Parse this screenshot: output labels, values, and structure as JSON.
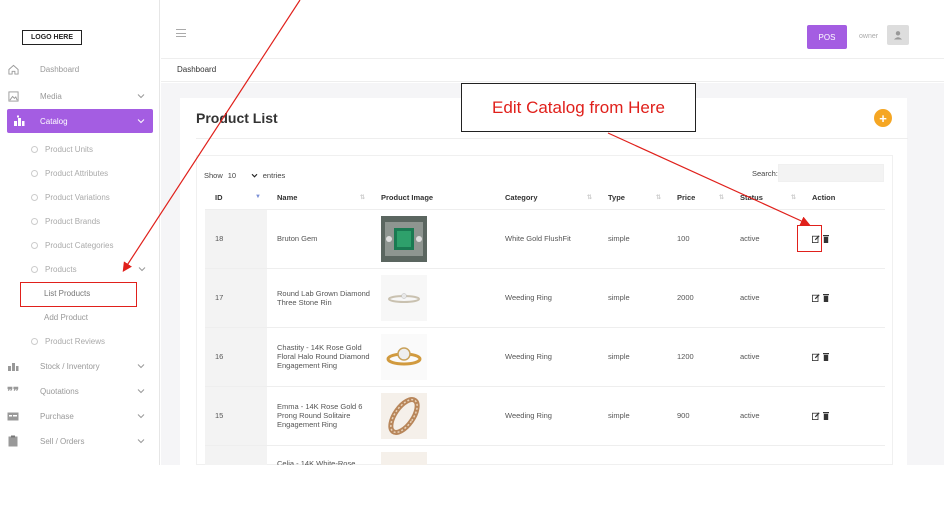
{
  "brand": {
    "logo_text": "LOGO HERE"
  },
  "topbar": {
    "pos_label": "POS",
    "user_name": "owner"
  },
  "breadcrumb": "Dashboard",
  "sidebar": {
    "items": [
      {
        "label": "Dashboard",
        "icon": "home-icon"
      },
      {
        "label": "Media",
        "icon": "image-icon"
      },
      {
        "label": "Catalog",
        "icon": "catalog-icon"
      }
    ],
    "catalog_sub": [
      "Product Units",
      "Product Attributes",
      "Product Variations",
      "Product Brands",
      "Product Categories",
      "Products"
    ],
    "products_sub": [
      "List Products",
      "Add Product"
    ],
    "after_sub": "Product Reviews",
    "lower_items": [
      {
        "label": "Stock / Inventory",
        "icon": "stock-icon"
      },
      {
        "label": "Quotations",
        "icon": "quote-icon"
      },
      {
        "label": "Purchase",
        "icon": "purchase-icon"
      },
      {
        "label": "Sell / Orders",
        "icon": "clipboard-icon"
      }
    ]
  },
  "page": {
    "title": "Product List"
  },
  "table_controls": {
    "show_label": "Show",
    "page_size": "10",
    "entries_label": "entries",
    "search_label": "Search:"
  },
  "table": {
    "columns": [
      "ID",
      "Name",
      "Product Image",
      "Category",
      "Type",
      "Price",
      "Status",
      "Action"
    ],
    "rows": [
      {
        "id": "18",
        "name": "Bruton Gem",
        "category": "White Gold FlushFit",
        "type": "simple",
        "price": "100",
        "status": "active"
      },
      {
        "id": "17",
        "name": "Round Lab Grown Diamond Three Stone Rin",
        "category": "Weeding Ring",
        "type": "simple",
        "price": "2000",
        "status": "active"
      },
      {
        "id": "16",
        "name": "Chastity - 14K Rose Gold Floral Halo Round Diamond Engagement Ring",
        "category": "Weeding Ring",
        "type": "simple",
        "price": "1200",
        "status": "active"
      },
      {
        "id": "15",
        "name": "Emma - 14K Rose Gold 6 Prong Round Solitaire Engagement Ring",
        "category": "Weeding Ring",
        "type": "simple",
        "price": "900",
        "status": "active"
      },
      {
        "id": "",
        "name": "Celia - 14K White-Rose",
        "category": "",
        "type": "",
        "price": "",
        "status": ""
      }
    ]
  },
  "annotation": {
    "callout_text": "Edit Catalog from Here",
    "color": "#e0201b"
  },
  "colors": {
    "accent": "#a45de2",
    "add_button": "#f5a623"
  }
}
